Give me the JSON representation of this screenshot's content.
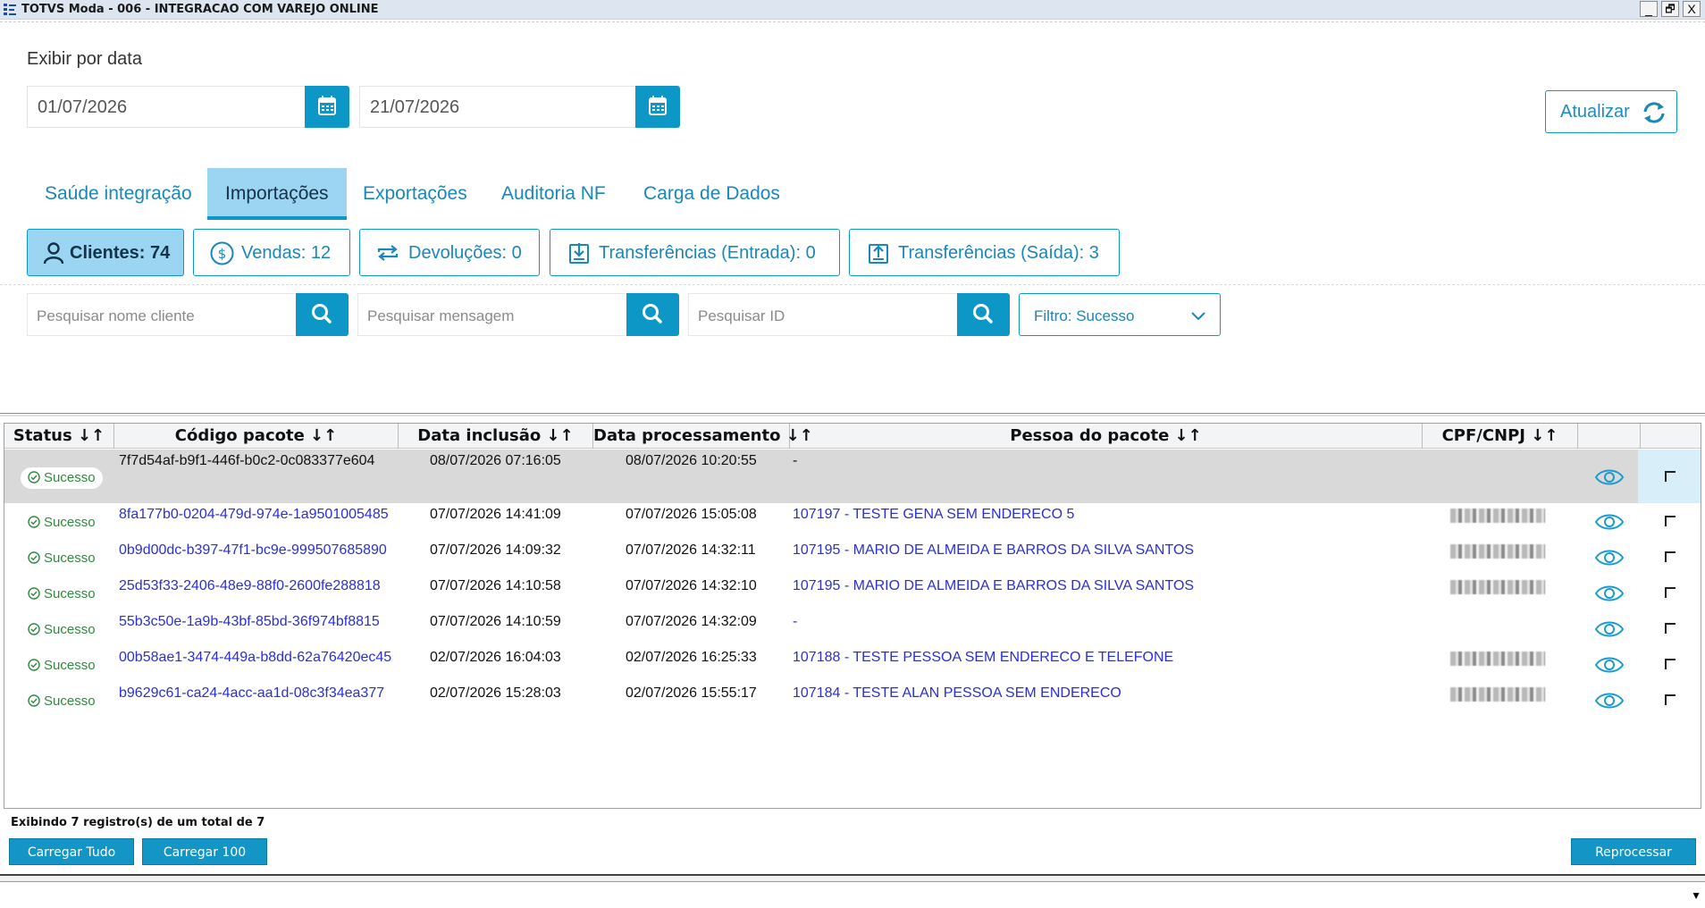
{
  "window": {
    "title": "TOTVS Moda - 006 - INTEGRACAO COM VAREJO ONLINE",
    "controls": [
      "_",
      "🗗",
      "X"
    ]
  },
  "filters": {
    "date_label": "Exibir por data",
    "date_from": "01/07/2026",
    "date_to": "21/07/2026",
    "refresh_label": "Atualizar"
  },
  "tabs": [
    {
      "label": "Saúde integração",
      "active": false
    },
    {
      "label": "Importações",
      "active": true
    },
    {
      "label": "Exportações",
      "active": false
    },
    {
      "label": "Auditoria NF",
      "active": false
    },
    {
      "label": "Carga de Dados",
      "active": false
    }
  ],
  "chips": [
    {
      "label": "Clientes: 74",
      "icon": "user-icon",
      "active": true
    },
    {
      "label": "Vendas: 12",
      "icon": "dollar-circle-icon",
      "active": false
    },
    {
      "label": "Devoluções: 0",
      "icon": "swap-icon",
      "active": false
    },
    {
      "label": "Transferências (Entrada): 0",
      "icon": "download-icon",
      "active": false
    },
    {
      "label": "Transferências (Saída): 3",
      "icon": "upload-icon",
      "active": false
    }
  ],
  "search": {
    "client_placeholder": "Pesquisar nome cliente",
    "message_placeholder": "Pesquisar mensagem",
    "id_placeholder": "Pesquisar ID",
    "filter_value": "Filtro: Sucesso"
  },
  "table": {
    "columns": [
      "Status ↓↑",
      "Código pacote ↓↑",
      "Data inclusão ↓↑",
      "Data processamento ↓↑",
      "Pessoa do pacote ↓↑",
      "CPF/CNPJ ↓↑",
      "",
      ""
    ],
    "rows": [
      {
        "status": "Sucesso",
        "code": "7f7d54af-b9f1-446f-b0c2-0c083377e604",
        "included": "08/07/2026 07:16:05",
        "processed": "08/07/2026 10:20:55",
        "person": "-",
        "has_cpf": false,
        "selected": true
      },
      {
        "status": "Sucesso",
        "code": "8fa177b0-0204-479d-974e-1a9501005485",
        "included": "07/07/2026 14:41:09",
        "processed": "07/07/2026 15:05:08",
        "person": "107197 - TESTE GENA SEM ENDERECO 5",
        "has_cpf": true,
        "selected": false
      },
      {
        "status": "Sucesso",
        "code": "0b9d00dc-b397-47f1-bc9e-999507685890",
        "included": "07/07/2026 14:09:32",
        "processed": "07/07/2026 14:32:11",
        "person": "107195 - MARIO DE ALMEIDA E BARROS DA SILVA SANTOS",
        "has_cpf": true,
        "selected": false
      },
      {
        "status": "Sucesso",
        "code": "25d53f33-2406-48e9-88f0-2600fe288818",
        "included": "07/07/2026 14:10:58",
        "processed": "07/07/2026 14:32:10",
        "person": "107195 - MARIO DE ALMEIDA E BARROS DA SILVA SANTOS",
        "has_cpf": true,
        "selected": false
      },
      {
        "status": "Sucesso",
        "code": "55b3c50e-1a9b-43bf-85bd-36f974bf8815",
        "included": "07/07/2026 14:10:59",
        "processed": "07/07/2026 14:32:09",
        "person": "-",
        "has_cpf": false,
        "selected": false
      },
      {
        "status": "Sucesso",
        "code": "00b58ae1-3474-449a-b8dd-62a76420ec45",
        "included": "02/07/2026 16:04:03",
        "processed": "02/07/2026 16:25:33",
        "person": "107188 - TESTE PESSOA SEM ENDERECO E TELEFONE",
        "has_cpf": true,
        "selected": false
      },
      {
        "status": "Sucesso",
        "code": "b9629c61-ca24-4acc-aa1d-08c3f34ea377",
        "included": "02/07/2026 15:28:03",
        "processed": "02/07/2026 15:55:17",
        "person": "107184 - TESTE ALAN PESSOA SEM ENDERECO",
        "has_cpf": true,
        "selected": false
      }
    ]
  },
  "footer": {
    "summary": "Exibindo 7 registro(s) de um total de 7",
    "load_all": "Carregar Tudo",
    "load_100": "Carregar 100",
    "reprocess": "Reprocessar"
  },
  "colors": {
    "accent": "#0d97c7",
    "active_tab": "#9bd5f1",
    "success": "#2e8a3d",
    "link": "#2a2fd6"
  }
}
